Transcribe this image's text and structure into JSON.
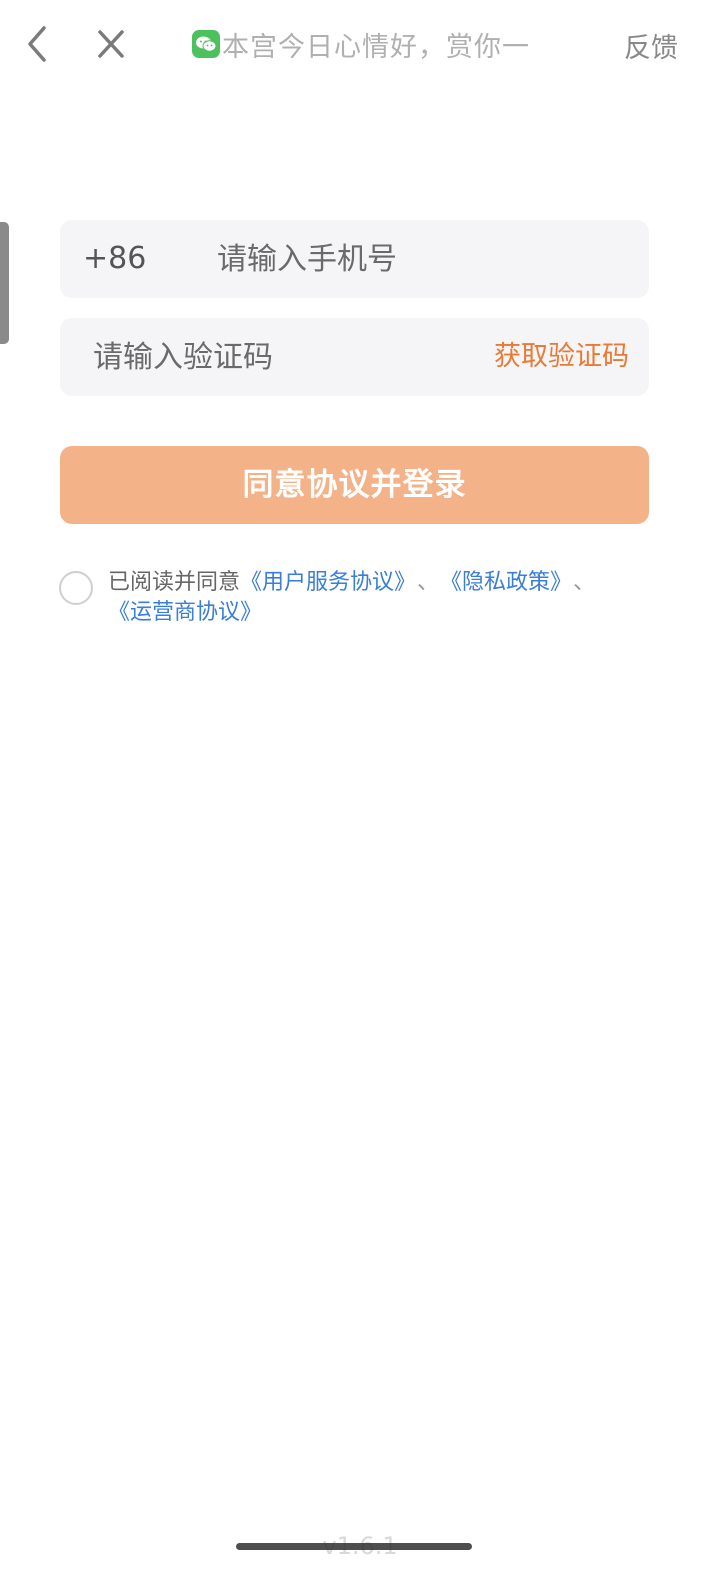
{
  "nav": {
    "back_icon": "chevron-left-icon",
    "close_icon": "close-icon",
    "title_icon": "wechat-icon",
    "title_text": "本宫今日心情好，赏你一",
    "feedback_label": "反馈"
  },
  "form": {
    "country_code": "+86",
    "phone_placeholder": "请输入手机号",
    "phone_value": "",
    "code_placeholder": "请输入验证码",
    "code_value": "",
    "get_code_label": "获取验证码"
  },
  "submit_label": "同意协议并登录",
  "agreement": {
    "checked": false,
    "prefix": "已阅读并同意",
    "user_agreement": "《用户服务协议》",
    "privacy_policy": "《隐私政策》",
    "operator_agreement": "《运营商协议》",
    "separator": "、"
  },
  "version": "v1.6.1",
  "colors": {
    "accent_orange": "#ea7a33",
    "button_bg": "#f3b287",
    "link_blue": "#3a7ed8",
    "wechat_green": "#4cc15d"
  }
}
